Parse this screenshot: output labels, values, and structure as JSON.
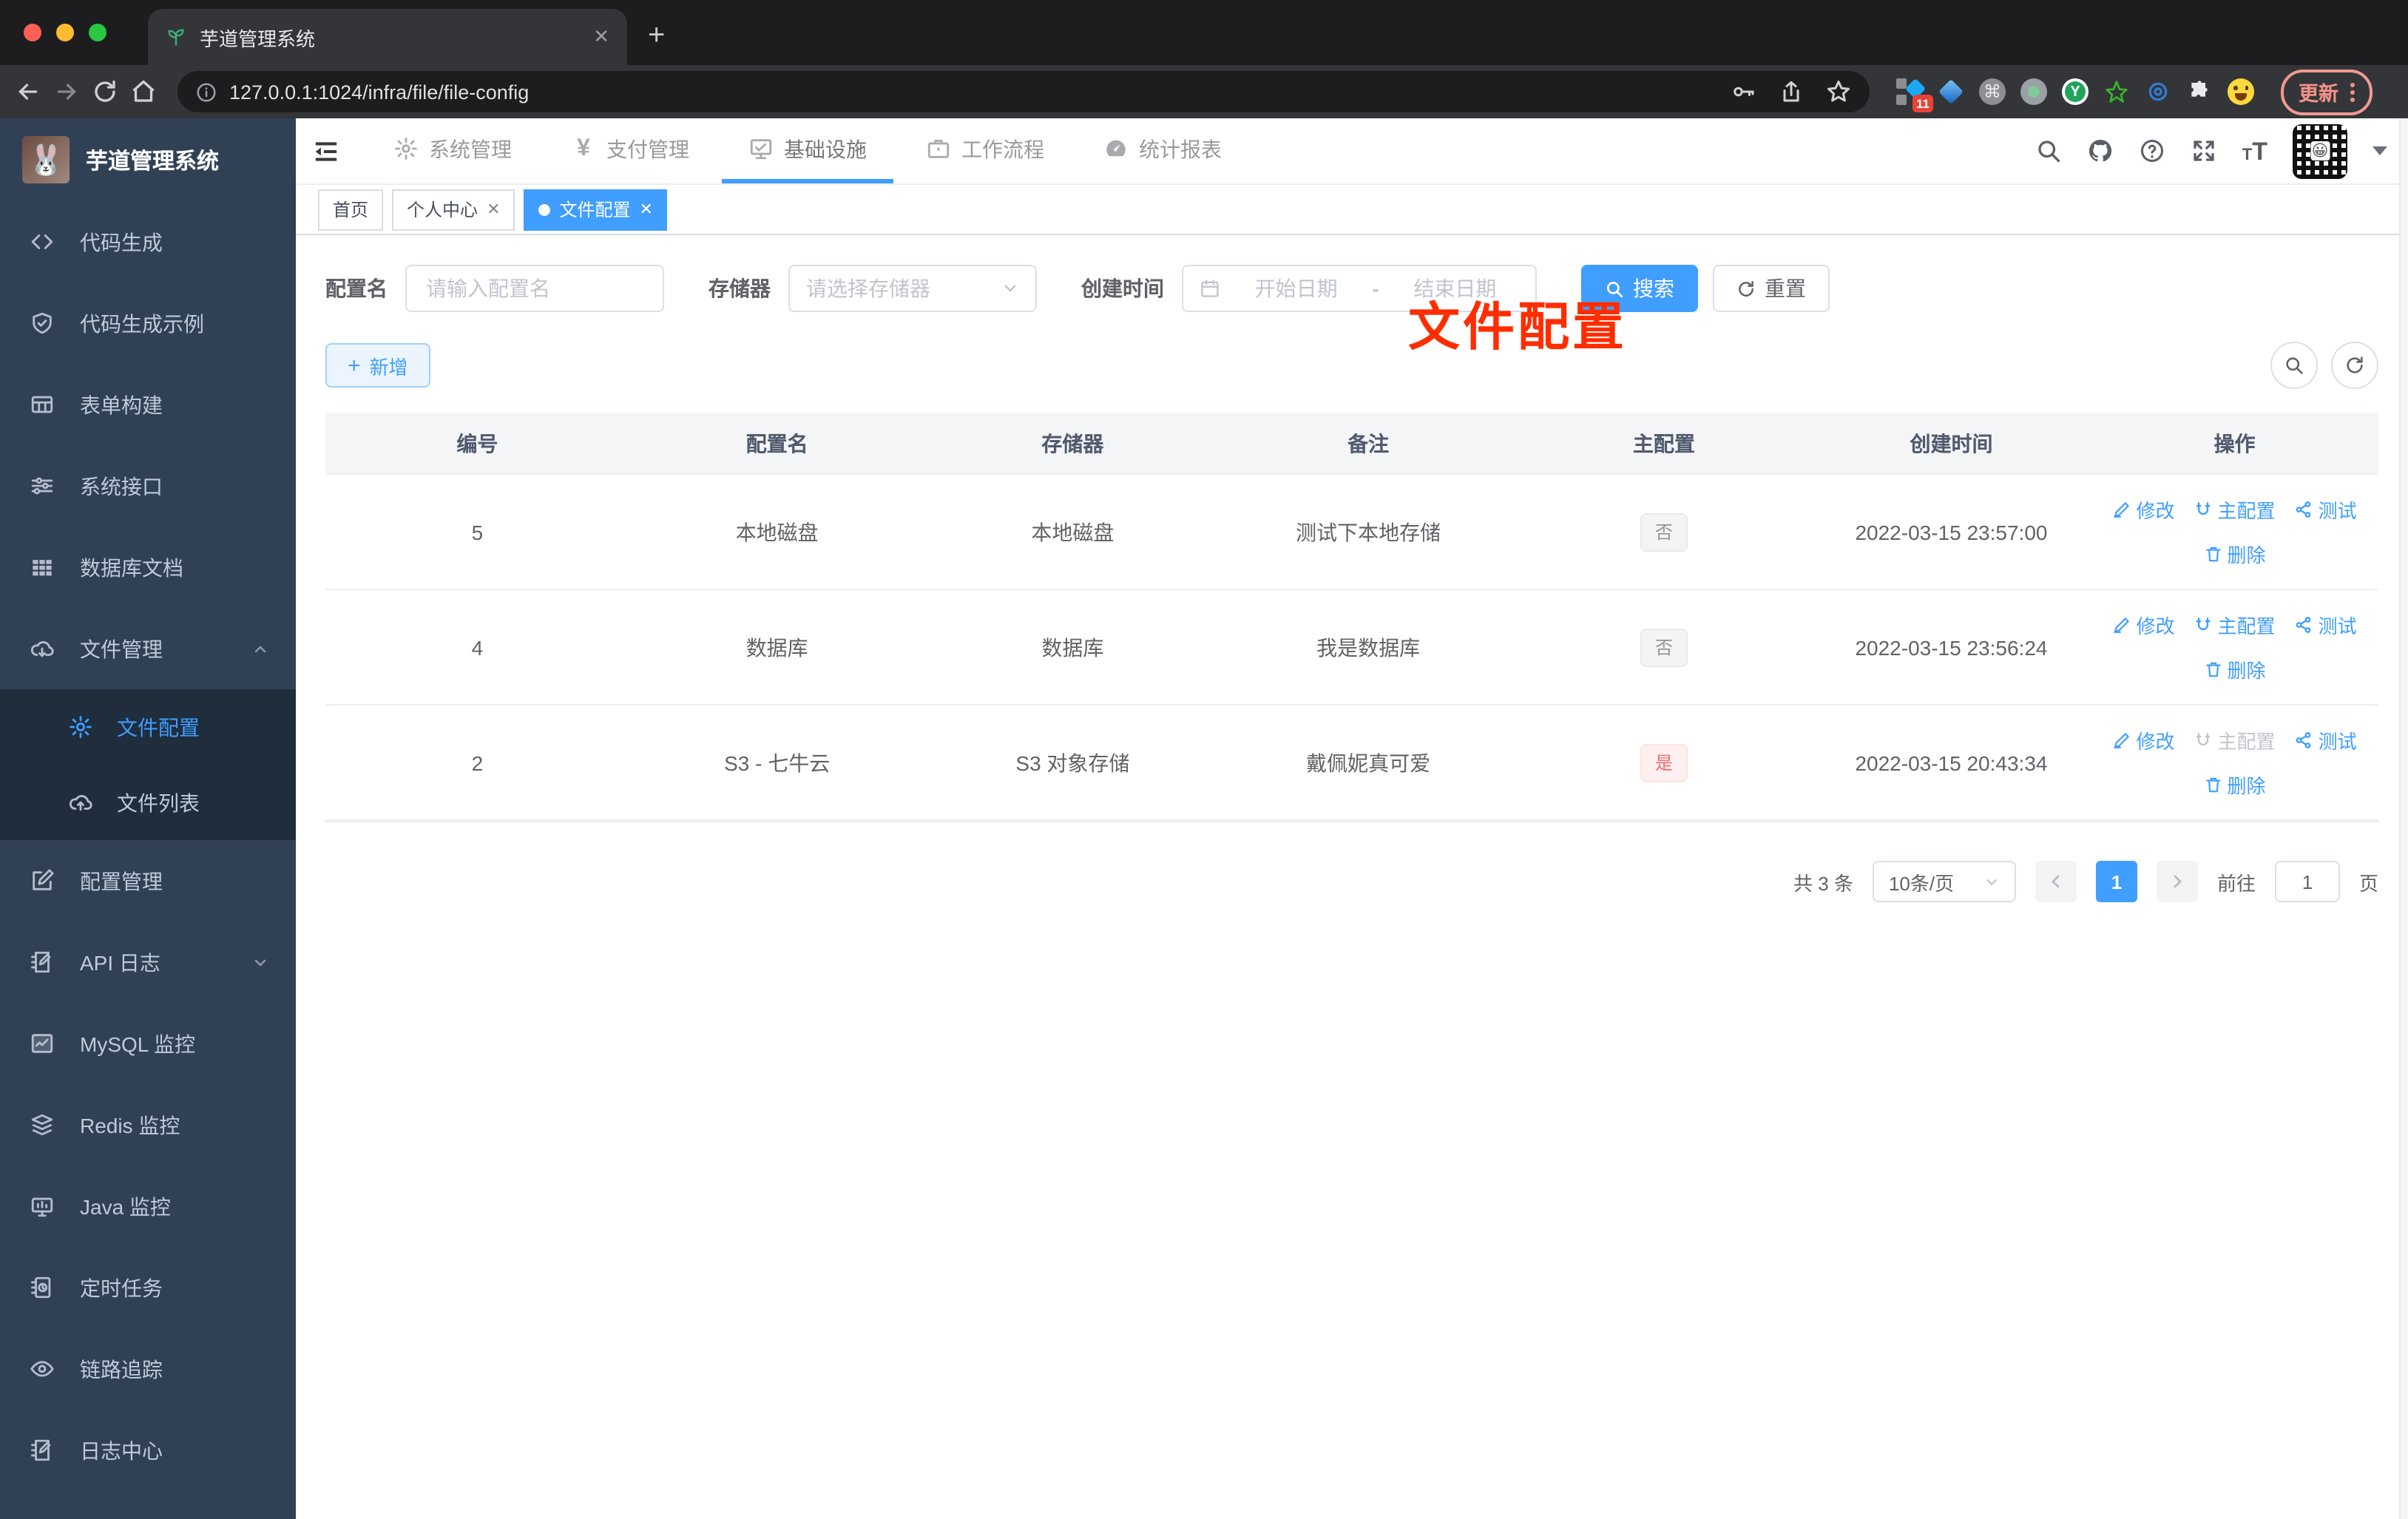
{
  "browser": {
    "tab_title": "芋道管理系统",
    "url": "127.0.0.1:1024/infra/file/file-config",
    "extension_badge": "11",
    "update_button": "更新"
  },
  "sidebar": {
    "title": "芋道管理系统",
    "items": [
      {
        "label": "代码生成",
        "icon": "code-icon"
      },
      {
        "label": "代码生成示例",
        "icon": "shield-check-icon"
      },
      {
        "label": "表单构建",
        "icon": "form-icon"
      },
      {
        "label": "系统接口",
        "icon": "sliders-icon"
      },
      {
        "label": "数据库文档",
        "icon": "grid-icon"
      },
      {
        "label": "文件管理",
        "icon": "cloud-download-icon",
        "expanded": true
      },
      {
        "label": "文件配置",
        "icon": "gear-icon",
        "active": true,
        "child": true
      },
      {
        "label": "文件列表",
        "icon": "cloud-upload-icon",
        "child": true
      },
      {
        "label": "配置管理",
        "icon": "edit-icon"
      },
      {
        "label": "API 日志",
        "icon": "log-edit-icon",
        "collapsed": true
      },
      {
        "label": "MySQL 监控",
        "icon": "chart-monitor-icon"
      },
      {
        "label": "Redis 监控",
        "icon": "layers-icon"
      },
      {
        "label": "Java 监控",
        "icon": "display-icon"
      },
      {
        "label": "定时任务",
        "icon": "schedule-icon"
      },
      {
        "label": "链路追踪",
        "icon": "eye-icon"
      },
      {
        "label": "日志中心",
        "icon": "log-center-icon"
      }
    ]
  },
  "navbar": {
    "items": [
      {
        "label": "系统管理",
        "icon": "gear-icon"
      },
      {
        "label": "支付管理",
        "icon": "yen-icon"
      },
      {
        "label": "基础设施",
        "icon": "monitor-check-icon",
        "active": true
      },
      {
        "label": "工作流程",
        "icon": "briefcase-icon"
      },
      {
        "label": "统计报表",
        "icon": "dashboard-icon"
      }
    ]
  },
  "tags": [
    {
      "label": "首页",
      "closable": false,
      "active": false
    },
    {
      "label": "个人中心",
      "closable": true,
      "active": false
    },
    {
      "label": "文件配置",
      "closable": true,
      "active": true
    }
  ],
  "annotation": "文件配置",
  "filters": {
    "name_label": "配置名",
    "name_placeholder": "请输入配置名",
    "storage_label": "存储器",
    "storage_placeholder": "请选择存储器",
    "time_label": "创建时间",
    "start_placeholder": "开始日期",
    "separator": "-",
    "end_placeholder": "结束日期",
    "search_label": "搜索",
    "reset_label": "重置"
  },
  "toolbar": {
    "add_label": "新增"
  },
  "table": {
    "headers": [
      "编号",
      "配置名",
      "存储器",
      "备注",
      "主配置",
      "创建时间",
      "操作"
    ],
    "action_labels": {
      "edit": "修改",
      "master": "主配置",
      "test": "测试",
      "remove": "删除"
    },
    "rows": [
      {
        "id": "5",
        "name": "本地磁盘",
        "storage": "本地磁盘",
        "remark": "测试下本地存储",
        "master": "否",
        "master_type": "info",
        "created": "2022-03-15 23:57:00",
        "master_action_disabled": false
      },
      {
        "id": "4",
        "name": "数据库",
        "storage": "数据库",
        "remark": "我是数据库",
        "master": "否",
        "master_type": "info",
        "created": "2022-03-15 23:56:24",
        "master_action_disabled": false
      },
      {
        "id": "2",
        "name": "S3 - 七牛云",
        "storage": "S3 对象存储",
        "remark": "戴佩妮真可爱",
        "master": "是",
        "master_type": "danger",
        "created": "2022-03-15 20:43:34",
        "master_action_disabled": true
      }
    ]
  },
  "pagination": {
    "total": "共 3 条",
    "page_size": "10条/页",
    "current_page": "1",
    "goto_label": "前往",
    "goto_value": "1",
    "page_unit": "页"
  },
  "colors": {
    "primary": "#409eff",
    "danger": "#f56c6c",
    "annotation_red": "#ff2d00",
    "sidebar_bg": "#304156",
    "submenu_bg": "#1f2d3d"
  }
}
